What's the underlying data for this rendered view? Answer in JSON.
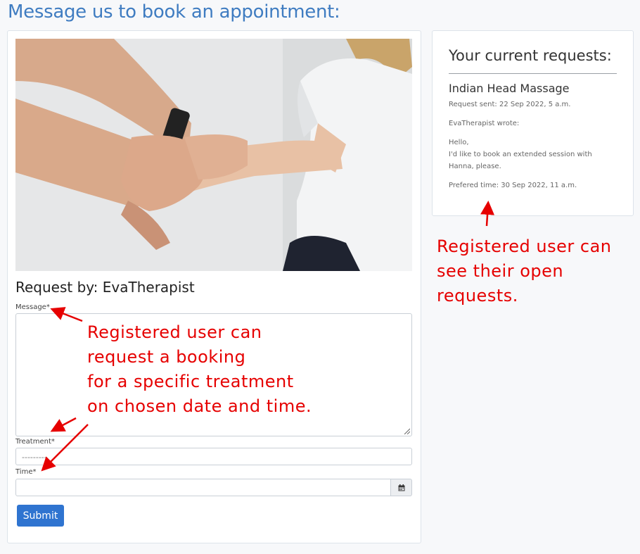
{
  "page": {
    "title": "Message us to book an appointment:"
  },
  "form": {
    "request_by": "Request by: EvaTherapist",
    "message_label": "Message*",
    "treatment_label": "Treatment*",
    "treatment_placeholder": "---------",
    "time_label": "Time*",
    "calendar_icon": "calendar-icon",
    "submit_label": "Submit",
    "photo_icon": "hands-photo"
  },
  "requests": {
    "title": "Your current requests:",
    "items": [
      {
        "treatment": "Indian Head Massage",
        "sent": "Request sent: 22 Sep 2022, 5 a.m.",
        "author": "EvaTherapist wrote:",
        "message_line1": "Hello,",
        "message_line2": "I'd like to book an extended session with",
        "message_line3": "Hanna, please.",
        "preferred_time": "Prefered time: 30 Sep 2022, 11 a.m."
      }
    ]
  },
  "annotations": {
    "left": [
      "Registered user can",
      "request a booking",
      "for a specific treatment",
      "on chosen date and time."
    ],
    "right": [
      "Registered user can",
      "see their open",
      "requests."
    ],
    "color": "#e60000"
  },
  "colors": {
    "accent": "#2f74d0",
    "title": "#3f7cc1"
  }
}
